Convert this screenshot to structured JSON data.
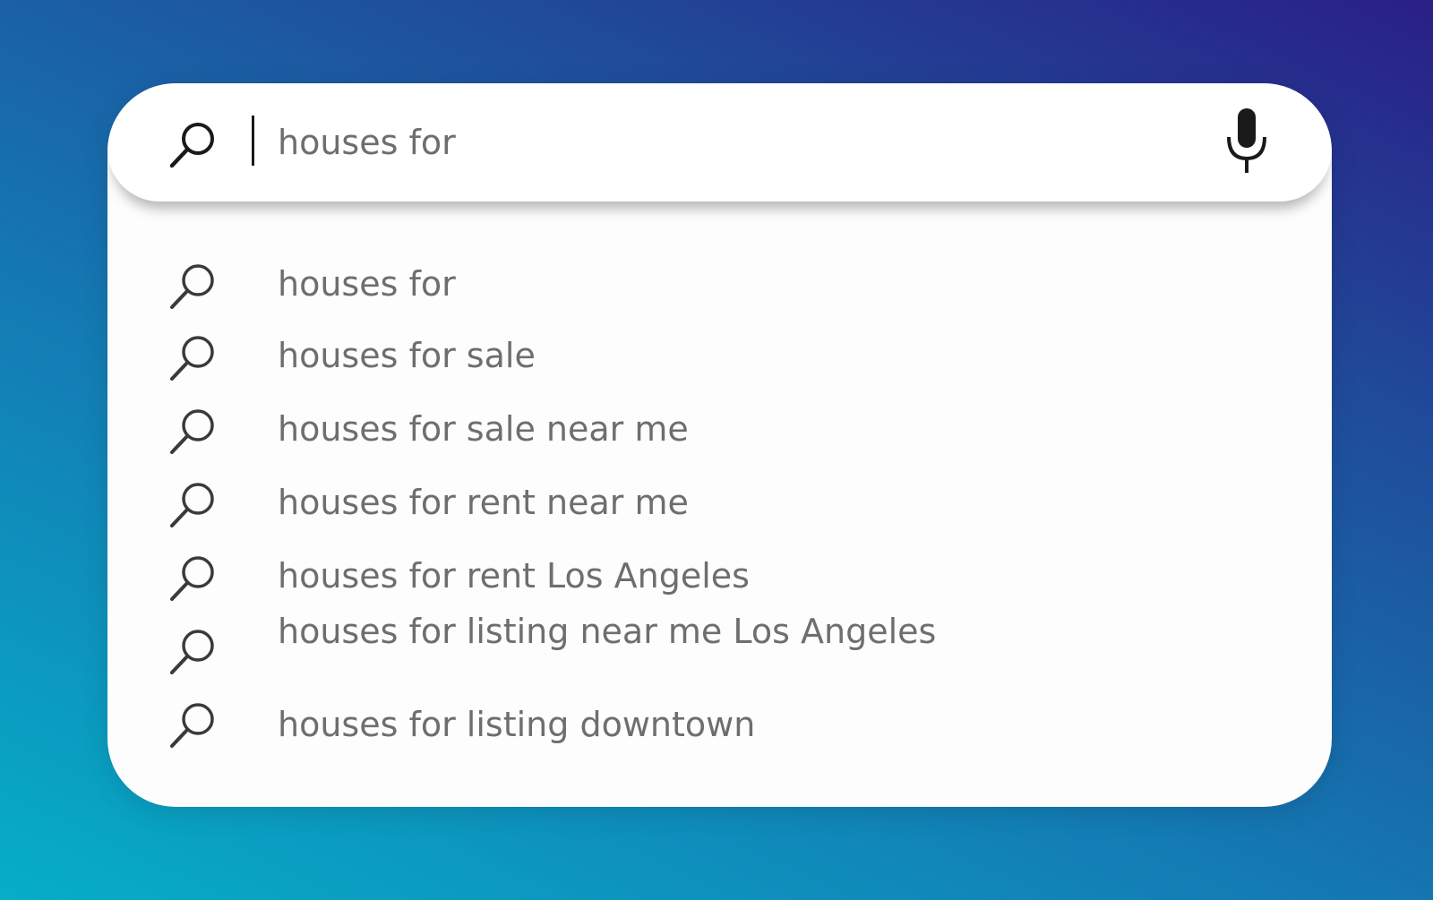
{
  "search": {
    "query": "houses for",
    "search_icon": "search-icon",
    "mic_icon": "microphone-icon"
  },
  "suggestions": [
    {
      "label": "houses for",
      "icon": "search-icon"
    },
    {
      "label": "houses for sale",
      "icon": "search-icon"
    },
    {
      "label": "houses for sale near me",
      "icon": "search-icon"
    },
    {
      "label": "houses for rent near me",
      "icon": "search-icon"
    },
    {
      "label": "houses for rent Los Angeles",
      "icon": "search-icon"
    },
    {
      "label": "houses for listing near me Los Angeles",
      "icon": "search-icon"
    },
    {
      "label": "houses for listing downtown",
      "icon": "search-icon"
    }
  ],
  "colors": {
    "background_top_right": "#2a1f86",
    "background_bottom_left": "#06aec8",
    "card": "#fdfdfd",
    "text": "#6e6e6e",
    "icon": "#3a3a3a"
  }
}
